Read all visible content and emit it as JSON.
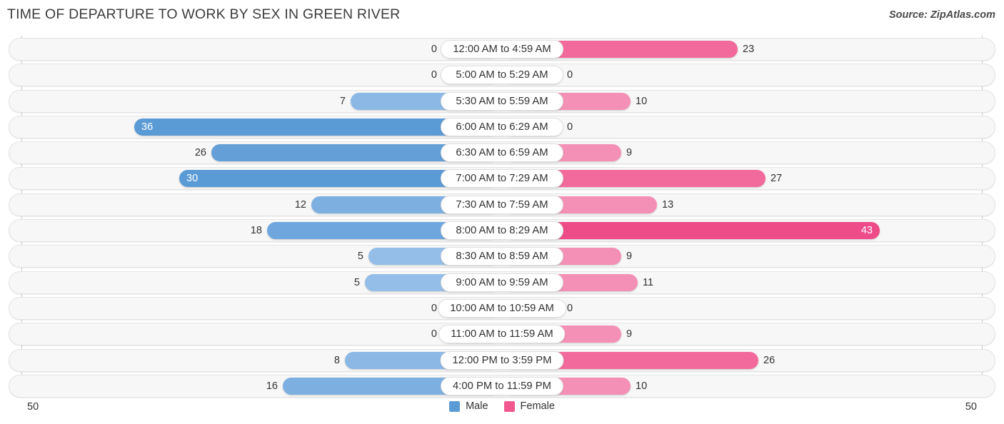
{
  "header": {
    "title": "TIME OF DEPARTURE TO WORK BY SEX IN GREEN RIVER",
    "source": "Source: ZipAtlas.com"
  },
  "axis": {
    "left_tick": "50",
    "right_tick": "50"
  },
  "legend": {
    "items": [
      {
        "label": "Male",
        "color": "#5b9bd5"
      },
      {
        "label": "Female",
        "color": "#f0578f"
      }
    ]
  },
  "colors": {
    "male_strong": "#5b9bd5",
    "male_mid": "#6fa6dd",
    "male_light": "#a8c8ec",
    "female_strong": "#ee4b89",
    "female_mid": "#f2699b",
    "female_light": "#f9a8c4"
  },
  "chart_data": {
    "type": "bar",
    "title": "TIME OF DEPARTURE TO WORK BY SEX IN GREEN RIVER",
    "subtitle": "Source: ZipAtlas.com",
    "orientation": "horizontal-diverging",
    "xlabel": "",
    "ylabel": "",
    "xlim": [
      50,
      50
    ],
    "grid": false,
    "legend_position": "bottom-center",
    "categories": [
      "12:00 AM to 4:59 AM",
      "5:00 AM to 5:29 AM",
      "5:30 AM to 5:59 AM",
      "6:00 AM to 6:29 AM",
      "6:30 AM to 6:59 AM",
      "7:00 AM to 7:29 AM",
      "7:30 AM to 7:59 AM",
      "8:00 AM to 8:29 AM",
      "8:30 AM to 8:59 AM",
      "9:00 AM to 9:59 AM",
      "10:00 AM to 10:59 AM",
      "11:00 AM to 11:59 AM",
      "12:00 PM to 3:59 PM",
      "4:00 PM to 11:59 PM"
    ],
    "series": [
      {
        "name": "Male",
        "values": [
          0,
          0,
          7,
          36,
          26,
          30,
          12,
          18,
          5,
          5,
          0,
          0,
          8,
          16
        ]
      },
      {
        "name": "Female",
        "values": [
          23,
          0,
          10,
          0,
          9,
          27,
          13,
          43,
          9,
          11,
          0,
          9,
          26,
          10
        ]
      }
    ]
  },
  "rows": [
    {
      "label": "12:00 AM to 4:59 AM",
      "male": "0",
      "female": "23",
      "male_w": 72,
      "female_w": 318,
      "male_color": "#a8c8ec",
      "female_color": "#f2699b",
      "male_inside": false,
      "female_inside": false
    },
    {
      "label": "5:00 AM to 5:29 AM",
      "male": "0",
      "female": "0",
      "male_w": 72,
      "female_w": 72,
      "male_color": "#a8c8ec",
      "female_color": "#f9a8c4",
      "male_inside": false,
      "female_inside": false
    },
    {
      "label": "5:30 AM to 5:59 AM",
      "male": "7",
      "female": "10",
      "male_w": 200,
      "female_w": 168,
      "male_color": "#8bb8e5",
      "female_color": "#f490b5",
      "male_inside": false,
      "female_inside": false
    },
    {
      "label": "6:00 AM to 6:29 AM",
      "male": "36",
      "female": "0",
      "male_w": 503,
      "female_w": 72,
      "male_color": "#5b9bd5",
      "female_color": "#f9a8c4",
      "male_inside": true,
      "female_inside": false
    },
    {
      "label": "6:30 AM to 6:59 AM",
      "male": "26",
      "female": "9",
      "male_w": 395,
      "female_w": 155,
      "male_color": "#649fd8",
      "female_color": "#f490b5",
      "male_inside": false,
      "female_inside": false
    },
    {
      "label": "7:00 AM to 7:29 AM",
      "male": "30",
      "female": "27",
      "male_w": 440,
      "female_w": 357,
      "male_color": "#5b9bd5",
      "female_color": "#f2699b",
      "male_inside": true,
      "female_inside": false
    },
    {
      "label": "7:30 AM to 7:59 AM",
      "male": "12",
      "female": "13",
      "male_w": 255,
      "female_w": 205,
      "male_color": "#7db0e1",
      "female_color": "#f490b5",
      "male_inside": false,
      "female_inside": false
    },
    {
      "label": "8:00 AM to 8:29 AM",
      "male": "18",
      "female": "43",
      "male_w": 317,
      "female_w": 517,
      "male_color": "#6fa6dd",
      "female_color": "#ee4b89",
      "male_inside": false,
      "female_inside": true
    },
    {
      "label": "8:30 AM to 8:59 AM",
      "male": "5",
      "female": "9",
      "male_w": 175,
      "female_w": 155,
      "male_color": "#94bee8",
      "female_color": "#f490b5",
      "male_inside": false,
      "female_inside": false
    },
    {
      "label": "9:00 AM to 9:59 AM",
      "male": "5",
      "female": "11",
      "male_w": 180,
      "female_w": 178,
      "male_color": "#94bee8",
      "female_color": "#f490b5",
      "male_inside": false,
      "female_inside": false
    },
    {
      "label": "10:00 AM to 10:59 AM",
      "male": "0",
      "female": "0",
      "male_w": 72,
      "female_w": 72,
      "male_color": "#a8c8ec",
      "female_color": "#f9a8c4",
      "male_inside": false,
      "female_inside": false
    },
    {
      "label": "11:00 AM to 11:59 AM",
      "male": "0",
      "female": "9",
      "male_w": 72,
      "female_w": 155,
      "male_color": "#a8c8ec",
      "female_color": "#f490b5",
      "male_inside": false,
      "female_inside": false
    },
    {
      "label": "12:00 PM to 3:59 PM",
      "male": "8",
      "female": "26",
      "male_w": 208,
      "female_w": 347,
      "male_color": "#8bb8e5",
      "female_color": "#f2699b",
      "male_inside": false,
      "female_inside": false
    },
    {
      "label": "4:00 PM to 11:59 PM",
      "male": "16",
      "female": "10",
      "male_w": 295,
      "female_w": 168,
      "male_color": "#7db0e1",
      "female_color": "#f490b5",
      "male_inside": false,
      "female_inside": false
    }
  ]
}
